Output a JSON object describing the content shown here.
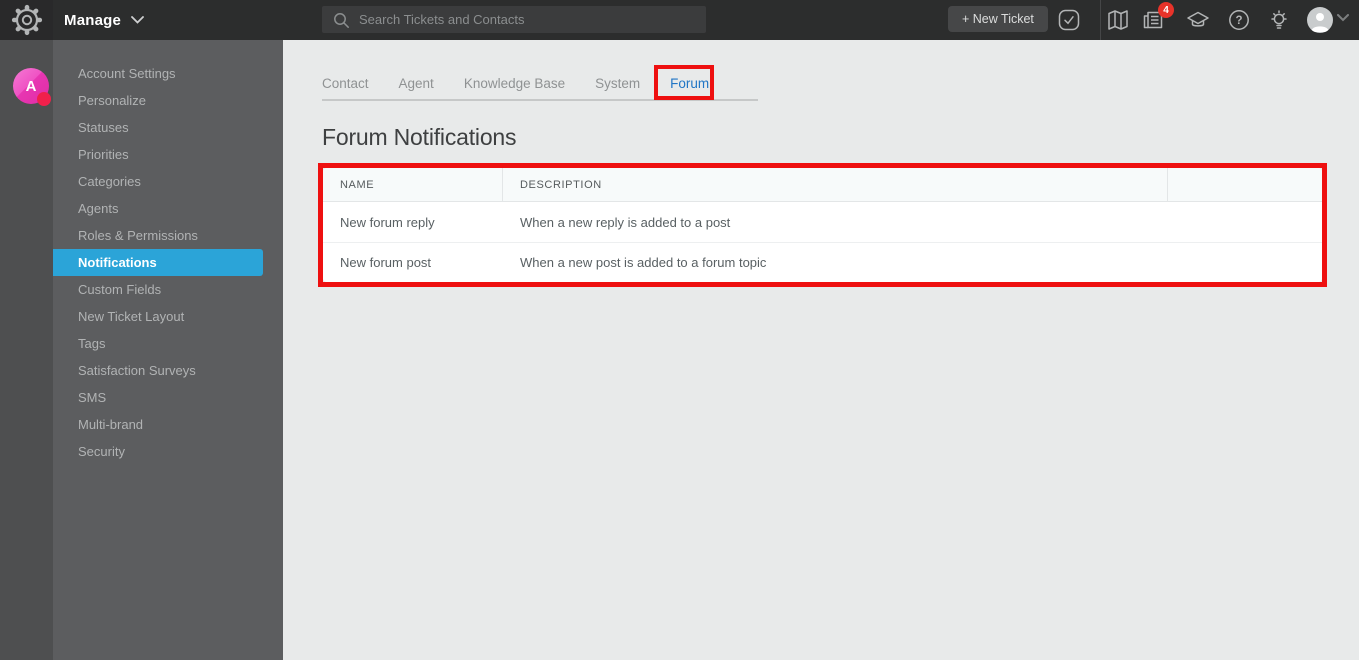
{
  "topbar": {
    "app_menu_label": "Manage",
    "search_placeholder": "Search Tickets and Contacts",
    "new_ticket_label": "+ New Ticket",
    "news_badge_count": "4",
    "icons": [
      "gear-icon",
      "search-icon",
      "tasks-check-icon",
      "map-icon",
      "news-icon",
      "graduation-cap-icon",
      "help-icon",
      "lightbulb-icon",
      "user-avatar",
      "chevron-down-icon"
    ]
  },
  "rail": {
    "avatar_letter": "A"
  },
  "sidebar": {
    "items": [
      {
        "label": "Account Settings"
      },
      {
        "label": "Personalize"
      },
      {
        "label": "Statuses"
      },
      {
        "label": "Priorities"
      },
      {
        "label": "Categories"
      },
      {
        "label": "Agents"
      },
      {
        "label": "Roles & Permissions"
      },
      {
        "label": "Notifications",
        "active": true
      },
      {
        "label": "Custom Fields"
      },
      {
        "label": "New Ticket Layout"
      },
      {
        "label": "Tags"
      },
      {
        "label": "Satisfaction Surveys"
      },
      {
        "label": "SMS"
      },
      {
        "label": "Multi-brand"
      },
      {
        "label": "Security"
      }
    ]
  },
  "main": {
    "tabs": [
      {
        "label": "Contact"
      },
      {
        "label": "Agent"
      },
      {
        "label": "Knowledge Base"
      },
      {
        "label": "System"
      },
      {
        "label": "Forum",
        "active": true
      }
    ],
    "heading": "Forum Notifications",
    "table": {
      "columns": [
        "NAME",
        "DESCRIPTION",
        ""
      ],
      "rows": [
        {
          "name": "New forum reply",
          "description": "When a new reply is added to a post"
        },
        {
          "name": "New forum post",
          "description": "When a new post is added to a forum topic"
        }
      ]
    }
  },
  "annotations": {
    "highlight_color": "#ee1010",
    "targets": [
      "forum-tab",
      "notifications-table"
    ]
  },
  "colors": {
    "topbar_bg": "#2c2d2d",
    "rail_bg": "#4e4f50",
    "sidebar_bg": "#5c5d5f",
    "sidebar_active_bg": "#2ba4d8",
    "main_bg": "#e8eaea",
    "tab_active": "#2176c5",
    "badge_red": "#e8332a",
    "avatar_pink": "#ec48c0",
    "presence_dot_red": "#f0204b"
  }
}
